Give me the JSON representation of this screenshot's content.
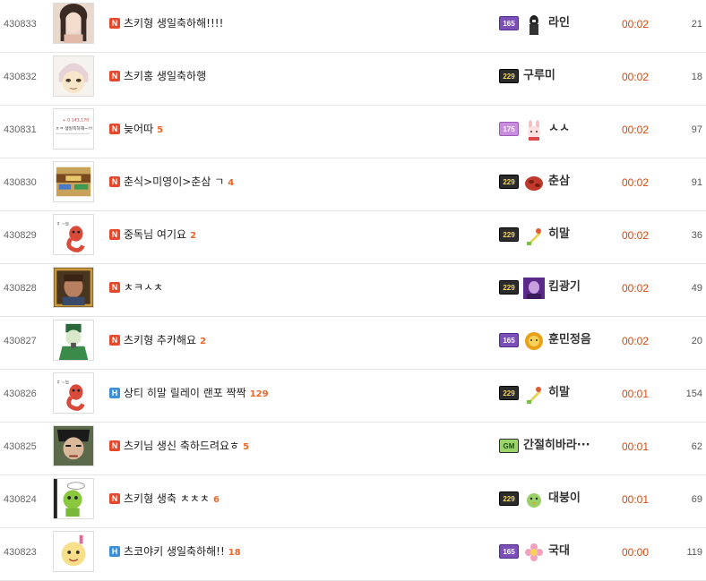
{
  "posts": [
    {
      "number": "430833",
      "badge": "N",
      "title": "츠키형 생일축하해!!!!",
      "comments": "",
      "level": "165",
      "level_style": "purple",
      "nickname": "라인",
      "time": "00:02",
      "views": "21",
      "thumb": "photo",
      "avatar": "dark-figure-icon"
    },
    {
      "number": "430832",
      "badge": "N",
      "title": "츠키홍 생일축하행",
      "comments": "",
      "level": "229",
      "level_style": "dark",
      "nickname": "구루미",
      "time": "00:02",
      "views": "18",
      "thumb": "anime-girl",
      "avatar": ""
    },
    {
      "number": "430831",
      "badge": "N",
      "title": "늦어따",
      "comments": "5",
      "level": "175",
      "level_style": "pink",
      "nickname": "ㅅㅅ",
      "time": "00:02",
      "views": "97",
      "thumb": "text-screenshot",
      "avatar": "rabbit-icon"
    },
    {
      "number": "430830",
      "badge": "N",
      "title": "춘식>미영이>춘삼 ㄱ",
      "comments": "4",
      "level": "229",
      "level_style": "dark",
      "nickname": "춘삼",
      "time": "00:02",
      "views": "91",
      "thumb": "game-screenshot",
      "avatar": "red-blob-icon"
    },
    {
      "number": "430829",
      "badge": "N",
      "title": "중독님 여기요",
      "comments": "2",
      "level": "229",
      "level_style": "dark",
      "nickname": "히말",
      "time": "00:02",
      "views": "36",
      "thumb": "red-character",
      "avatar": "potion-icon"
    },
    {
      "number": "430828",
      "badge": "N",
      "title": "ㅊㅋㅅㅊ",
      "comments": "",
      "level": "229",
      "level_style": "dark",
      "nickname": "킴광기",
      "time": "00:02",
      "views": "49",
      "thumb": "man-portrait",
      "avatar": "purple-portrait-icon"
    },
    {
      "number": "430827",
      "badge": "N",
      "title": "츠키형 추카해요",
      "comments": "2",
      "level": "165",
      "level_style": "purple",
      "nickname": "훈민정음",
      "time": "00:02",
      "views": "20",
      "thumb": "green-king",
      "avatar": "gold-coin-icon"
    },
    {
      "number": "430826",
      "badge": "H",
      "title": "상티 히말 릴레이 랜포 짝짝",
      "comments": "129",
      "level": "229",
      "level_style": "dark",
      "nickname": "히말",
      "time": "00:01",
      "views": "154",
      "thumb": "red-character",
      "avatar": "potion-icon"
    },
    {
      "number": "430825",
      "badge": "N",
      "title": "츠키님 생신 축하드려요ㅎ",
      "comments": "5",
      "level": "GM",
      "level_style": "green",
      "nickname": "간절히바라···",
      "time": "00:01",
      "views": "62",
      "thumb": "manga-man",
      "avatar": ""
    },
    {
      "number": "430824",
      "badge": "N",
      "title": "츠키형 생축 ㅊㅊㅊ",
      "comments": "6",
      "level": "229",
      "level_style": "dark",
      "nickname": "대붕이",
      "time": "00:01",
      "views": "69",
      "thumb": "green-creature",
      "avatar": "green-chick-icon"
    },
    {
      "number": "430823",
      "badge": "H",
      "title": "츠코야키 생일축하해!!",
      "comments": "18",
      "level": "165",
      "level_style": "purple",
      "nickname": "국대",
      "time": "00:00",
      "views": "119",
      "thumb": "cartoon-baby",
      "avatar": "flower-icon"
    }
  ],
  "thumb_texts": {
    "t2": "ㅊㅋ 생일축하해~!!!",
    "t2b": "+ 0 143,170",
    "t5": "ㅎ ~늘"
  },
  "colors": {
    "time": "#d24a10",
    "comments": "#e8672b",
    "badge_new": "#e8472b",
    "badge_hot": "#3a8fd8"
  }
}
